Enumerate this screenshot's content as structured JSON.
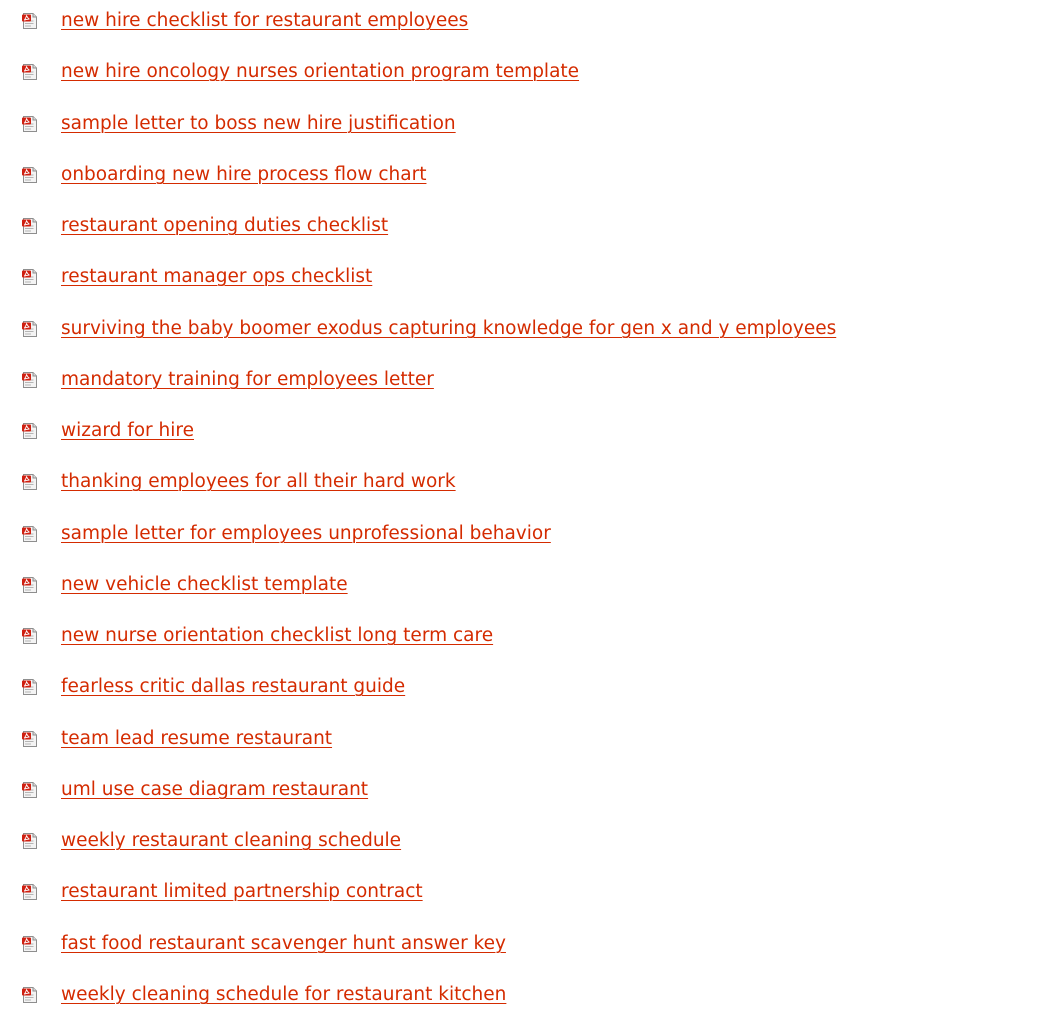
{
  "documents": [
    {
      "title": "new hire checklist for restaurant employees",
      "icon": "pdf-file-icon"
    },
    {
      "title": "new hire oncology nurses orientation program template",
      "icon": "pdf-file-icon"
    },
    {
      "title": "sample letter to boss new hire justification",
      "icon": "pdf-file-icon"
    },
    {
      "title": "onboarding new hire process flow chart",
      "icon": "pdf-file-icon"
    },
    {
      "title": "restaurant opening duties checklist",
      "icon": "pdf-file-icon"
    },
    {
      "title": "restaurant manager ops checklist",
      "icon": "pdf-file-icon"
    },
    {
      "title": "surviving the baby boomer exodus capturing knowledge for gen x and y employees",
      "icon": "pdf-file-icon"
    },
    {
      "title": "mandatory training for employees letter",
      "icon": "pdf-file-icon"
    },
    {
      "title": "wizard for hire",
      "icon": "pdf-file-icon"
    },
    {
      "title": "thanking employees for all their hard work",
      "icon": "pdf-file-icon"
    },
    {
      "title": "sample letter for employees unprofessional behavior",
      "icon": "pdf-file-icon"
    },
    {
      "title": "new vehicle checklist template",
      "icon": "pdf-file-icon"
    },
    {
      "title": "new nurse orientation checklist long term care",
      "icon": "pdf-file-icon"
    },
    {
      "title": "fearless critic dallas restaurant guide",
      "icon": "pdf-file-icon"
    },
    {
      "title": "team lead resume restaurant",
      "icon": "pdf-file-icon"
    },
    {
      "title": "uml use case diagram restaurant",
      "icon": "pdf-file-icon"
    },
    {
      "title": "weekly restaurant cleaning schedule",
      "icon": "pdf-file-icon"
    },
    {
      "title": "restaurant limited partnership contract",
      "icon": "pdf-file-icon"
    },
    {
      "title": "fast food restaurant scavenger hunt answer key",
      "icon": "pdf-file-icon"
    },
    {
      "title": "weekly cleaning schedule for restaurant kitchen",
      "icon": "pdf-file-icon"
    }
  ],
  "colors": {
    "link": "#d42b00",
    "background": "#ffffff"
  }
}
